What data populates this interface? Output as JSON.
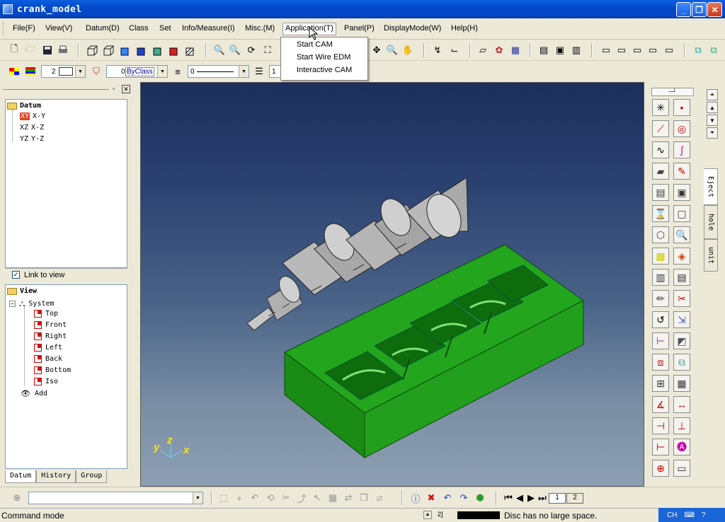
{
  "window": {
    "title": "crank_model"
  },
  "menu": {
    "items": [
      "File(F)",
      "View(V)",
      "Datum(D)",
      "Class",
      "Set",
      "Info/Measure(I)",
      "Misc.(M)",
      "Application(T)",
      "Panel(P)",
      "DisplayMode(W)",
      "Help(H)"
    ],
    "open_index": 7,
    "application_items": [
      "Start CAM",
      "Start Wire EDM",
      "Interactive CAM"
    ]
  },
  "toolbar2": {
    "line_width_value": "2",
    "layer_value": "0",
    "color_value": "ByClass",
    "line_style_value": "0",
    "weight_value": "1"
  },
  "datum_tree": {
    "root": "Datum",
    "items": [
      {
        "code": "XY",
        "label": "X-Y",
        "selected": true
      },
      {
        "code": "XZ",
        "label": "X-Z",
        "selected": false
      },
      {
        "code": "YZ",
        "label": "Y-Z",
        "selected": false
      }
    ]
  },
  "link_to_view": {
    "label": "Link to view",
    "checked": true
  },
  "view_tree": {
    "root": "View",
    "system": "System",
    "items": [
      "Top",
      "Front",
      "Right",
      "Left",
      "Back",
      "Bottom",
      "Iso"
    ],
    "add": "Add"
  },
  "left_tabs": [
    "Datum",
    "History",
    "Group"
  ],
  "triad": {
    "y": "y",
    "z": "z",
    "x": "x"
  },
  "palette_top": "─┘",
  "side_tabs": [
    "Eject",
    "hole",
    "unit"
  ],
  "bottom": {
    "pages": [
      "1",
      "2"
    ]
  },
  "status": {
    "mode": "Command mode",
    "bracket": "2]",
    "message": "Disc has no large space.",
    "lang": "CH"
  },
  "colors": {
    "viewport_top": "#1c2f5c",
    "viewport_bottom": "#8e9fb3",
    "mold": "#1ea01a",
    "crank": "#b8b8b8"
  }
}
